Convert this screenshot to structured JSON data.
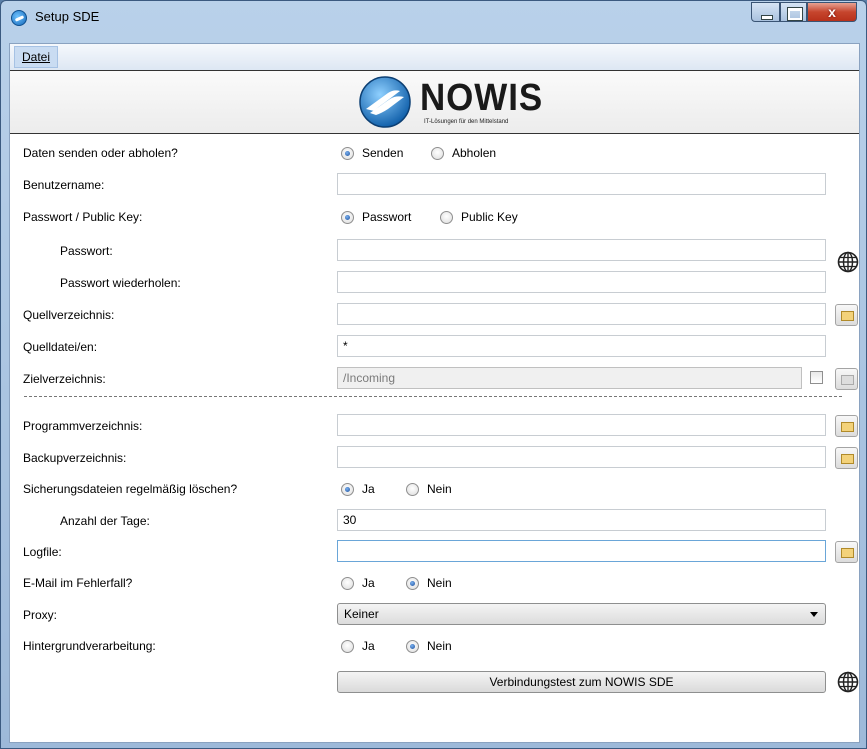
{
  "window": {
    "title": "Setup SDE"
  },
  "menu": {
    "datei": "Datei"
  },
  "logo": {
    "word": "NOWIS",
    "tagline": "IT-Lösungen für den Mittelstand"
  },
  "form": {
    "send_mode": {
      "label": "Daten senden oder abholen?",
      "option1": "Senden",
      "option2": "Abholen",
      "selected": "Senden"
    },
    "username": {
      "label": "Benutzername:",
      "value": ""
    },
    "auth_mode": {
      "label": "Passwort / Public Key:",
      "option1": "Passwort",
      "option2": "Public Key",
      "selected": "Passwort"
    },
    "password": {
      "label": "Passwort:",
      "value": ""
    },
    "password_repeat": {
      "label": "Passwort wiederholen:",
      "value": ""
    },
    "source_dir": {
      "label": "Quellverzeichnis:",
      "value": ""
    },
    "source_files": {
      "label": "Quelldatei/en:",
      "value": "*"
    },
    "target_dir": {
      "label": "Zielverzeichnis:",
      "value": "/Incoming"
    },
    "program_dir": {
      "label": "Programmverzeichnis:",
      "value": ""
    },
    "backup_dir": {
      "label": "Backupverzeichnis:",
      "value": ""
    },
    "delete_backups": {
      "label": "Sicherungsdateien regelmäßig löschen?",
      "option1": "Ja",
      "option2": "Nein",
      "selected": "Ja"
    },
    "days": {
      "label": "Anzahl der Tage:",
      "value": "30"
    },
    "logfile": {
      "label": "Logfile:",
      "value": ""
    },
    "email_on_error": {
      "label": "E-Mail im Fehlerfall?",
      "option1": "Ja",
      "option2": "Nein",
      "selected": "Nein"
    },
    "proxy": {
      "label": "Proxy:",
      "value": "Keiner"
    },
    "background": {
      "label": "Hintergrundverarbeitung:",
      "option1": "Ja",
      "option2": "Nein",
      "selected": "Nein"
    },
    "test_button": "Verbindungstest zum NOWIS SDE"
  }
}
